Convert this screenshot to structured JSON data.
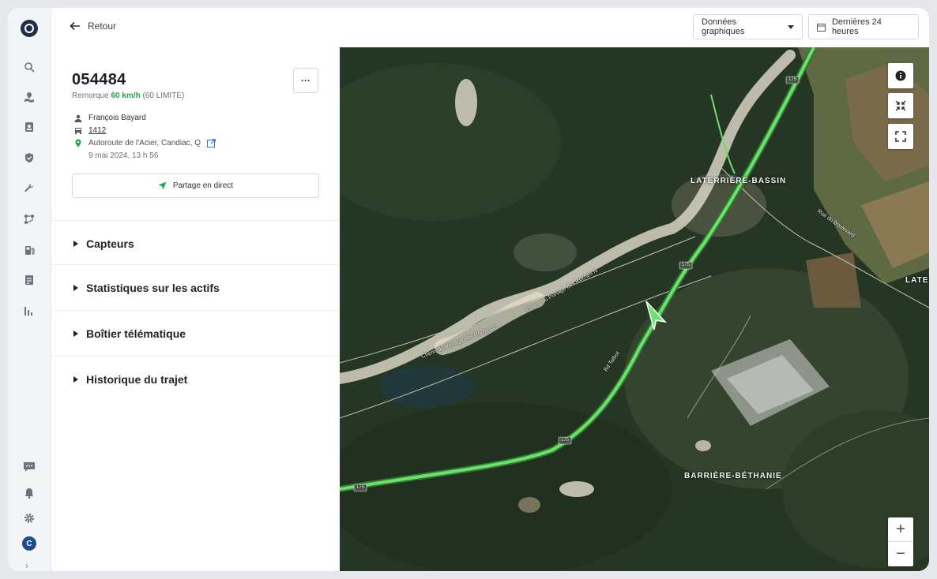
{
  "topbar": {
    "back_label": "Retour",
    "data_dropdown": "Données graphiques",
    "time_range": "Dernières 24 heures"
  },
  "asset": {
    "id": "054484",
    "type": "Remorque",
    "speed": "60 km/h",
    "limit": "(60 LIMITE)",
    "driver": "François Bayard",
    "vehicle": "1412",
    "location": "Autoroute de l'Acier, Candiac, Q",
    "timestamp": "9 mai 2024, 13 h 56",
    "share_label": "Partage en direct"
  },
  "sections": [
    {
      "label": "Capteurs"
    },
    {
      "label": "Statistiques sur les actifs"
    },
    {
      "label": "Boîtier télématique"
    },
    {
      "label": "Historique du trajet"
    }
  ],
  "map": {
    "places": [
      "LATERRIÈRE-BASSIN",
      "BARRIÈRE-BÉTHANIE",
      "LATE"
    ],
    "roads": [
      "Chem. du Portage des Roches N",
      "Chem. du Portage des Roches S",
      "Bd Talbot",
      "Rue du Boulevard",
      "175"
    ],
    "route_color": "#5fd35f",
    "zoom_in": "+",
    "zoom_out": "−"
  },
  "rail": {
    "icons": [
      "search-icon",
      "map-icon",
      "driver-icon",
      "safety-shield-icon",
      "wrench-icon",
      "route-icon",
      "fuel-icon",
      "document-icon",
      "reports-icon",
      "chat-icon",
      "bell-icon",
      "gear-icon"
    ],
    "avatar_initial": "C"
  }
}
